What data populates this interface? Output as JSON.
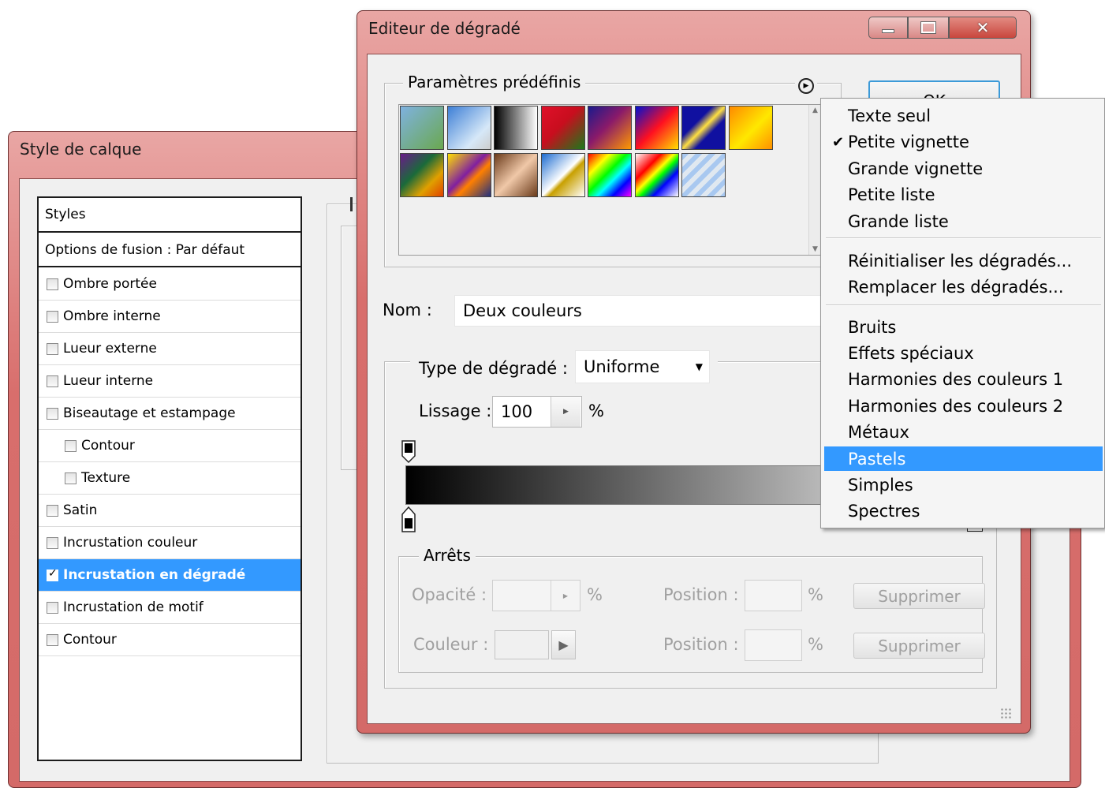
{
  "style_dialog": {
    "title": "Style de calque",
    "list_header": "Styles",
    "blend_options": "Options de fusion : Par défaut",
    "items": [
      {
        "label": "Ombre portée",
        "checked": false,
        "indent": false,
        "selected": false
      },
      {
        "label": "Ombre interne",
        "checked": false,
        "indent": false,
        "selected": false
      },
      {
        "label": "Lueur externe",
        "checked": false,
        "indent": false,
        "selected": false
      },
      {
        "label": "Lueur interne",
        "checked": false,
        "indent": false,
        "selected": false
      },
      {
        "label": "Biseautage et estampage",
        "checked": false,
        "indent": false,
        "selected": false
      },
      {
        "label": "Contour",
        "checked": false,
        "indent": true,
        "selected": false
      },
      {
        "label": "Texture",
        "checked": false,
        "indent": true,
        "selected": false
      },
      {
        "label": "Satin",
        "checked": false,
        "indent": false,
        "selected": false
      },
      {
        "label": "Incrustation couleur",
        "checked": false,
        "indent": false,
        "selected": false
      },
      {
        "label": "Incrustation en dégradé",
        "checked": true,
        "indent": false,
        "selected": true
      },
      {
        "label": "Incrustation de motif",
        "checked": false,
        "indent": false,
        "selected": false
      },
      {
        "label": "Contour",
        "checked": false,
        "indent": false,
        "selected": false
      }
    ]
  },
  "gradient_editor": {
    "title": "Editeur de dégradé",
    "presets_label": "Paramètres prédéfinis",
    "ok_label": "OK",
    "name_label": "Nom :",
    "name_value": "Deux couleurs",
    "type_label": "Type de dégradé :",
    "type_value": "Uniforme",
    "smooth_label": "Lissage :",
    "smooth_value": "100",
    "smooth_unit": "%",
    "stops_label": "Arrêts",
    "opacity_label": "Opacité :",
    "opacity_unit": "%",
    "color_label": "Couleur :",
    "position_label": "Position :",
    "position_unit": "%",
    "delete_label": "Supprimer",
    "swatches_row1": [
      "linear-gradient(135deg,#7fb2e0,#6aa84f)",
      "linear-gradient(135deg,#3d7fd6,#d6e8f8 70%,#cccccc)",
      "linear-gradient(90deg,#000,#fff)",
      "linear-gradient(135deg,#e0102a,#c80e1e 45%,#1a7a1a)",
      "linear-gradient(135deg,#1a1a8c,#8a1a6a 45%,#ff9a00)",
      "linear-gradient(135deg,#0010d0,#ff1020 50%,#ffe000)",
      "linear-gradient(135deg,#1010a0,#1010a0 35%,#ffe040 50%,#1010a0 65%)",
      "linear-gradient(135deg,#ff8a00,#ffe800 55%,#ff9000)"
    ],
    "swatches_row2": [
      "linear-gradient(135deg,#6a1a8a,#1a6a3a 40%,#e0a000 70%,#e04000)",
      "linear-gradient(135deg,#ffe000,#8020a0 45%,#ff8000 60%,#203080)",
      "linear-gradient(135deg,#6a3a1a,#f0c8a8 50%,#6a3a1a)",
      "linear-gradient(135deg,#1a6ad0,#ffffff 50%,#c8a000 58%,#ffffff)",
      "linear-gradient(135deg,#ff0000,#ffff00 25%,#00ff00 45%,#00ffff 60%,#0000ff 78%,#ff00ff)",
      "linear-gradient(135deg,#ffffff,#ff0000 30%,#ffff00 45%,#00ff00 55%,#0000ff 70%,#ffffff)",
      "repeating-linear-gradient(135deg,#a8c8f0 0 6px,#e0e8f0 6px 12px)"
    ]
  },
  "dropdown_menu": {
    "group1": [
      {
        "label": "Texte seul",
        "checked": false
      },
      {
        "label": "Petite vignette",
        "checked": true
      },
      {
        "label": "Grande vignette",
        "checked": false
      },
      {
        "label": "Petite liste",
        "checked": false
      },
      {
        "label": "Grande liste",
        "checked": false
      }
    ],
    "group2": [
      {
        "label": "Réinitialiser les dégradés...",
        "checked": false
      },
      {
        "label": "Remplacer les dégradés...",
        "checked": false
      }
    ],
    "group3": [
      {
        "label": "Bruits",
        "selected": false
      },
      {
        "label": "Effets spéciaux",
        "selected": false
      },
      {
        "label": "Harmonies des couleurs 1",
        "selected": false
      },
      {
        "label": "Harmonies des couleurs 2",
        "selected": false
      },
      {
        "label": "Métaux",
        "selected": false
      },
      {
        "label": "Pastels",
        "selected": true
      },
      {
        "label": "Simples",
        "selected": false
      },
      {
        "label": "Spectres",
        "selected": false
      }
    ],
    "check_glyph": "✔"
  },
  "colors": {
    "selection": "#3399ff",
    "window_frame": "#d86e6c",
    "close_button": "#c9463d"
  },
  "icons": {
    "menu_arrow": "circle-arrow-right-icon",
    "minimize": "minimize-icon",
    "maximize": "maximize-icon",
    "close": "close-icon"
  }
}
